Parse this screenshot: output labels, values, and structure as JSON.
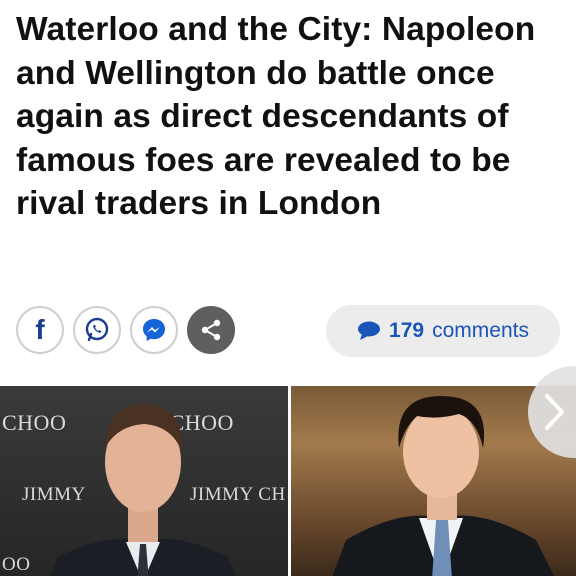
{
  "article": {
    "headline": "Waterloo and the City: Napoleon and Wellington do battle once again as direct descendants of famous foes are revealed to be rival traders in London"
  },
  "share": {
    "buttons": [
      {
        "name": "facebook-icon",
        "glyph": "f"
      },
      {
        "name": "whatsapp-icon"
      },
      {
        "name": "messenger-icon"
      },
      {
        "name": "share-more-icon"
      }
    ]
  },
  "comments": {
    "count": "179",
    "label": "comments",
    "color": "#1a55b8"
  },
  "gallery": {
    "left_photo": {
      "backdrop_texts": [
        "CHOO",
        "Y CHOO",
        "JIMMY",
        "JIMMY CH",
        "OO"
      ]
    },
    "right_photo": {},
    "next_icon": "chevron-right-icon"
  }
}
